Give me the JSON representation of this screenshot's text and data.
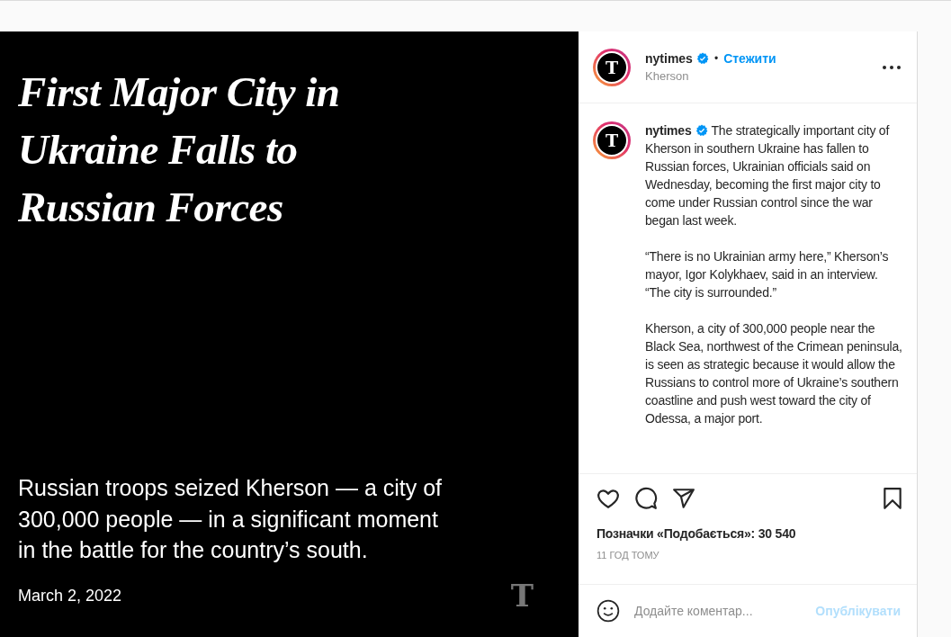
{
  "post_image": {
    "headline": [
      "First Major City in",
      "Ukraine Falls to",
      "Russian Forces"
    ],
    "summary": [
      "Russian troops seized Kherson — a city of",
      "300,000 people — in a significant moment",
      "in the battle for the country’s south."
    ],
    "date": "March 2, 2022",
    "logo_glyph": "T"
  },
  "header": {
    "avatar_glyph": "T",
    "username": "nytimes",
    "verified": true,
    "separator": "•",
    "follow": "Стежити",
    "location": "Kherson"
  },
  "caption": {
    "avatar_glyph": "T",
    "username": "nytimes",
    "verified": true,
    "paragraphs": [
      "The strategically important city of Kherson in southern Ukraine has fallen to Russian forces, Ukrainian officials said on Wednesday, becoming the first major city to come under Russian control since the war began last week.",
      "“There is no Ukrainian army here,” Kherson’s mayor, Igor Kolykhaev, said in an interview. “The city is surrounded.”",
      "Kherson, a city of 300,000 people near the Black Sea, northwest of the Crimean peninsula, is seen as strategic because it would allow the Russians to control more of Ukraine’s southern coastline and push west toward the city of Odessa, a major port."
    ]
  },
  "actions": {
    "liked": false,
    "saved": false
  },
  "likes": "Позначки «Подобається»: 30 540",
  "time": "11 ГОД ТОМУ",
  "comment": {
    "placeholder": "Додайте коментар...",
    "post": "Опублікувати",
    "post_disabled": true
  }
}
